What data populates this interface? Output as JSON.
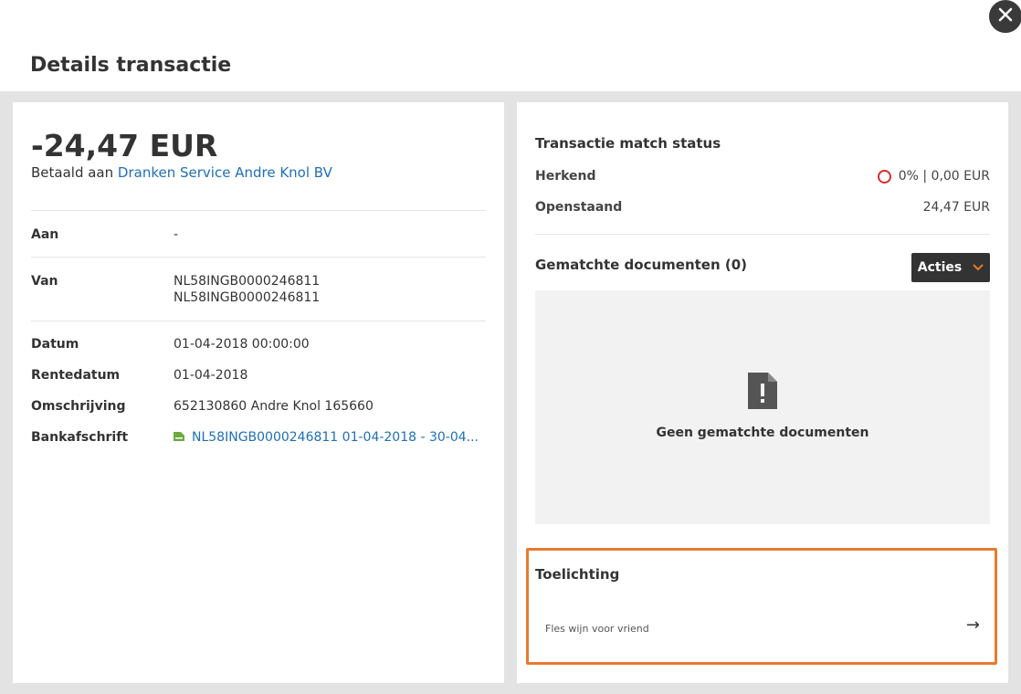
{
  "modal": {
    "title": "Details transactie",
    "close_icon": "close-icon"
  },
  "transaction": {
    "amount": "-24,47 EUR",
    "paid_to_prefix": "Betaald aan",
    "paid_to_name": "Dranken Service Andre Knol BV",
    "rows": {
      "aan": {
        "label": "Aan",
        "value": "-"
      },
      "van": {
        "label": "Van",
        "value_line1": "NL58INGB0000246811",
        "value_line2": "NL58INGB0000246811"
      },
      "datum": {
        "label": "Datum",
        "value": "01-04-2018 00:00:00"
      },
      "rentedatum": {
        "label": "Rentedatum",
        "value": "01-04-2018"
      },
      "omschrijving": {
        "label": "Omschrijving",
        "value": "652130860 Andre Knol 165660"
      },
      "bankafschrift": {
        "label": "Bankafschrift",
        "value": "NL58INGB0000246811 01-04-2018 - 30-04...",
        "icon": "bank-statement-icon"
      }
    }
  },
  "match_status": {
    "title": "Transactie match status",
    "herkend_label": "Herkend",
    "herkend_value": "0% | 0,00 EUR",
    "openstaand_label": "Openstaand",
    "openstaand_value": "24,47 EUR",
    "status_color": "#d32f2f"
  },
  "documents": {
    "title": "Gematchte documenten (0)",
    "actions_label": "Acties",
    "empty_text": "Geen gematchte documenten",
    "empty_icon": "document-warning-icon"
  },
  "note": {
    "title": "Toelichting",
    "value": "Fles wijn voor vriend",
    "highlight_color": "#e87a2f"
  },
  "colors": {
    "link": "#1f6fb5",
    "accent": "#e87a2f",
    "dark_button": "#333333"
  }
}
